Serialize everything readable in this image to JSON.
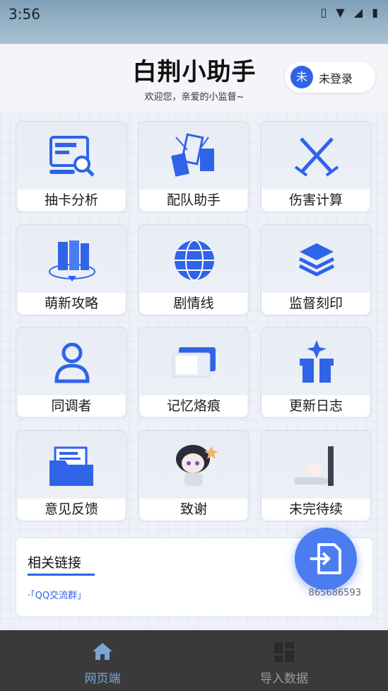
{
  "status_bar": {
    "time": "3:56"
  },
  "header": {
    "app_title": "白荆小助手",
    "welcome": "欢迎您，亲爱的小监督~",
    "login": {
      "avatar_text": "未",
      "label": "未登录"
    }
  },
  "tiles": [
    {
      "label": "抽卡分析",
      "icon": "analysis-icon"
    },
    {
      "label": "配队助手",
      "icon": "cards-icon"
    },
    {
      "label": "伤害计算",
      "icon": "crossed-swords-icon"
    },
    {
      "label": "萌新攻略",
      "icon": "books-icon"
    },
    {
      "label": "剧情线",
      "icon": "globe-icon"
    },
    {
      "label": "监督刻印",
      "icon": "layers-icon"
    },
    {
      "label": "同调者",
      "icon": "user-icon"
    },
    {
      "label": "记忆烙痕",
      "icon": "memory-card-icon"
    },
    {
      "label": "更新日志",
      "icon": "gift-box-icon"
    },
    {
      "label": "意见反馈",
      "icon": "folder-icon"
    },
    {
      "label": "致谢",
      "icon": "chibi-character-icon"
    },
    {
      "label": "未完待续",
      "icon": "chibi-sleeping-icon"
    }
  ],
  "links": {
    "title": "相关链接",
    "item": "·「QQ交流群」",
    "number": "865686593"
  },
  "fab": {
    "icon": "import-icon"
  },
  "bottom_nav": {
    "items": [
      {
        "label": "网页端",
        "icon": "home-icon",
        "active": true
      },
      {
        "label": "导入数据",
        "icon": "grid-icon",
        "active": false
      }
    ]
  },
  "colors": {
    "accent": "#2f64e8",
    "nav_bg": "#3a3a3a",
    "nav_active": "#7aa6d6"
  }
}
